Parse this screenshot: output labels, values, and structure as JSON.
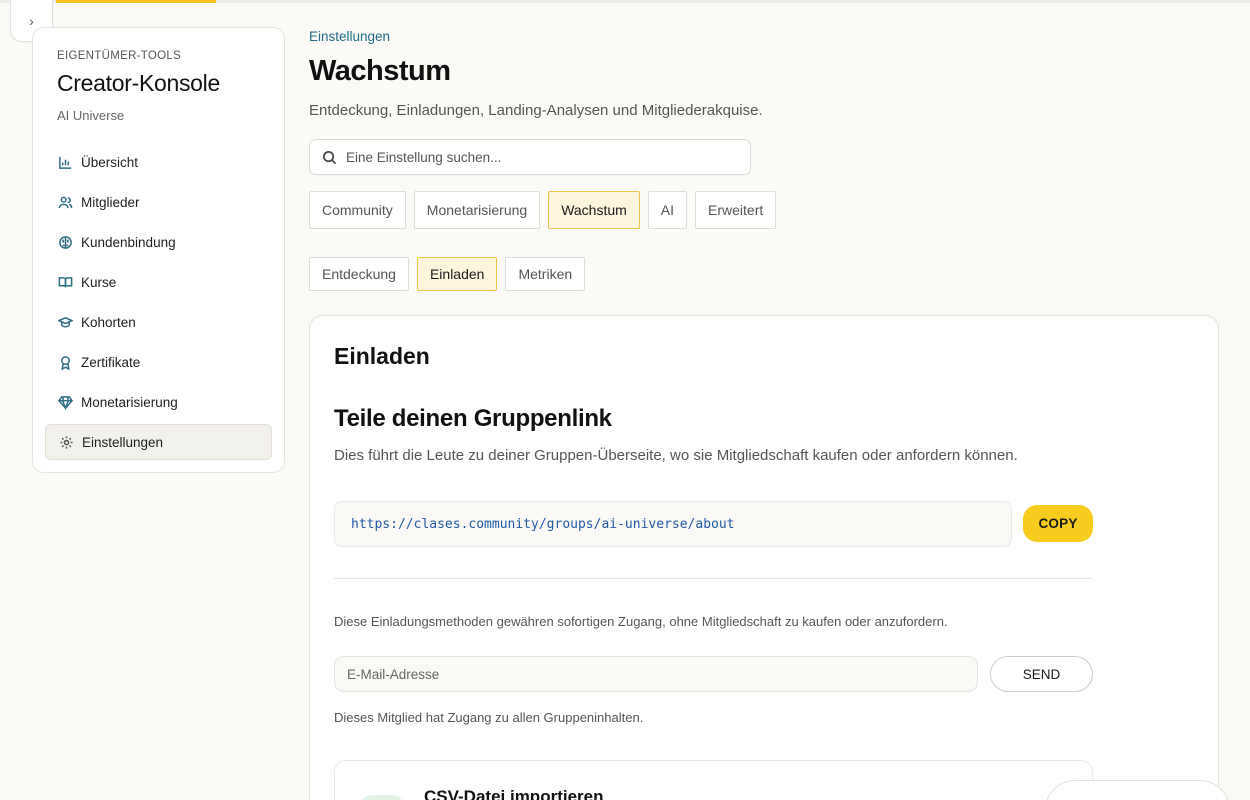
{
  "sidebar": {
    "eyebrow": "EIGENTÜMER-TOOLS",
    "title": "Creator-Konsole",
    "subtitle": "AI Universe",
    "items": [
      {
        "label": "Übersicht",
        "icon": "bar-chart-icon"
      },
      {
        "label": "Mitglieder",
        "icon": "users-icon"
      },
      {
        "label": "Kundenbindung",
        "icon": "brain-icon"
      },
      {
        "label": "Kurse",
        "icon": "book-icon"
      },
      {
        "label": "Kohorten",
        "icon": "graduation-cap-icon"
      },
      {
        "label": "Zertifikate",
        "icon": "award-icon"
      },
      {
        "label": "Monetarisierung",
        "icon": "gem-icon"
      },
      {
        "label": "Einstellungen",
        "icon": "gear-icon",
        "active": true
      }
    ]
  },
  "header": {
    "breadcrumb": "Einstellungen",
    "title": "Wachstum",
    "description": "Entdeckung, Einladungen, Landing-Analysen und Mitgliederakquise.",
    "search_placeholder": "Eine Einstellung suchen..."
  },
  "tabs": {
    "primary": [
      "Community",
      "Monetarisierung",
      "Wachstum",
      "AI",
      "Erweitert"
    ],
    "primary_active": "Wachstum",
    "secondary": [
      "Entdeckung",
      "Einladen",
      "Metriken"
    ],
    "secondary_active": "Einladen"
  },
  "card": {
    "title": "Einladen",
    "section_title": "Teile deinen Gruppenlink",
    "section_desc": "Dies führt die Leute zu deiner Gruppen-Überseite, wo sie Mitgliedschaft kaufen oder anfordern können.",
    "link": "https://clases.community/groups/ai-universe/about",
    "copy_label": "COPY",
    "invite_note": "Diese Einladungsmethoden gewähren sofortigen Zugang, ohne Mitgliedschaft zu kaufen oder anzufordern.",
    "email_placeholder": "E-Mail-Adresse",
    "send_label": "SEND",
    "access_note": "Dieses Mitglied hat Zugang zu allen Gruppeninhalten.",
    "csv_title": "CSV-Datei importieren"
  },
  "colors": {
    "accent": "#f8cc1c",
    "link": "#1f6b86",
    "icon": "#2d6e84"
  }
}
